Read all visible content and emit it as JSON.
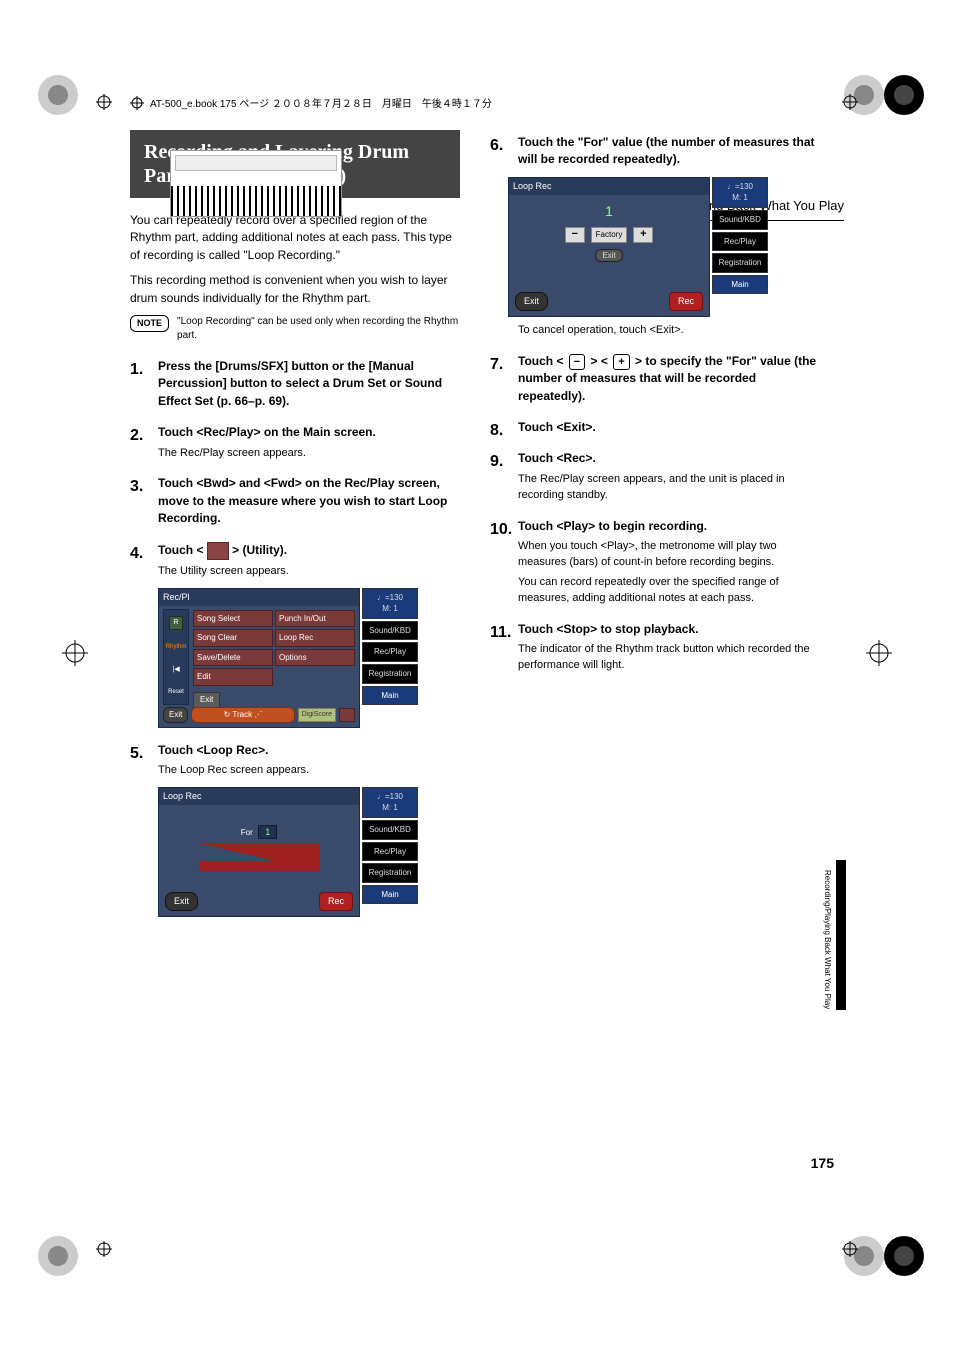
{
  "header_line": "AT-500_e.book  175 ページ  ２００８年７月２８日　月曜日　午後４時１７分",
  "section_title": "Recording/Playing Back What You Play",
  "main_title": "Recording and Layering Drum Parts (Loop Recording)",
  "intro_p1": "You can repeatedly record over a specified region of the Rhythm part, adding additional notes at each pass. This type of recording is called \"Loop Recording.\"",
  "intro_p2": "This recording method is convenient when you wish to layer drum sounds individually for the Rhythm part.",
  "note_label": "NOTE",
  "note_text": "\"Loop Recording\" can be used only when recording the Rhythm part.",
  "steps_left": [
    {
      "head": "Press the [Drums/SFX] button or the [Manual Percussion] button to select a Drum Set or Sound Effect Set (p. 66–p. 69).",
      "sub": ""
    },
    {
      "head": "Touch <Rec/Play> on the Main screen.",
      "sub": "The Rec/Play screen appears."
    },
    {
      "head": "Touch <Bwd> and <Fwd> on the Rec/Play screen, move to the measure where you wish to start Loop Recording.",
      "sub": ""
    },
    {
      "head_pre": "Touch < ",
      "head_post": " > (Utility).",
      "sub": "The Utility screen appears."
    },
    {
      "head": "Touch <Loop Rec>.",
      "sub": "The Loop Rec screen appears."
    }
  ],
  "utility_shot": {
    "title": "Rec/Pl",
    "menu": [
      "Song Select",
      "Punch In/Out",
      "Song Clear",
      "Loop Rec",
      "Save/Delete",
      "Options",
      "Edit",
      ""
    ],
    "exit": "Exit",
    "left_r": "R",
    "left_label": "Rhythm",
    "left_reset": "Reset",
    "bottom_exit": "Exit",
    "bottom_track": "Track",
    "bottom_digi": "DigiScore",
    "tempo": "♩=130",
    "meas": "M:    1",
    "side": [
      "Sound/KBD",
      "Rec/Play",
      "Registration",
      "Main"
    ]
  },
  "looprec_shot1": {
    "title": "Loop Rec",
    "for_label": "For",
    "for_val": "1",
    "exit": "Exit",
    "rec": "Rec",
    "tempo": "♩=130",
    "meas": "M:    1",
    "side": [
      "Sound/KBD",
      "Rec/Play",
      "Registration",
      "Main"
    ]
  },
  "steps_right": [
    {
      "n": "6",
      "head": "Touch the \"For\" value (the number of measures that will be recorded repeatedly).",
      "sub": ""
    },
    {
      "n": "7",
      "head_pre": "Touch < ",
      "head_mid": " > < ",
      "head_post": " > to specify the \"For\" value (the number of measures that will be recorded repeatedly).",
      "sub": ""
    },
    {
      "n": "8",
      "head": "Touch <Exit>.",
      "sub": ""
    },
    {
      "n": "9",
      "head": "Touch <Rec>.",
      "sub": "The Rec/Play screen appears, and the unit is placed in recording standby."
    },
    {
      "n": "10",
      "head": "Touch <Play> to begin recording.",
      "sub": "When you touch <Play>, the metronome will play two measures (bars) of count-in before recording begins.",
      "sub2": "You can record repeatedly over the specified range of measures, adding additional notes at each pass."
    },
    {
      "n": "11",
      "head": "Touch <Stop> to stop playback.",
      "sub": "The indicator of the Rhythm track button which recorded the performance will light."
    }
  ],
  "looprec_shot2": {
    "title": "Loop Rec",
    "num": "1",
    "minus": "−",
    "plus": "+",
    "factory": "Factory",
    "inner_exit": "Exit",
    "exit": "Exit",
    "rec": "Rec",
    "tempo": "♩=130",
    "meas": "M:    1",
    "side": [
      "Sound/KBD",
      "Rec/Play",
      "Registration",
      "Main"
    ]
  },
  "cancel_note": "To cancel operation, touch <Exit>.",
  "side_tab_text": "Recording/Playing Back What You Play",
  "page_number": "175"
}
